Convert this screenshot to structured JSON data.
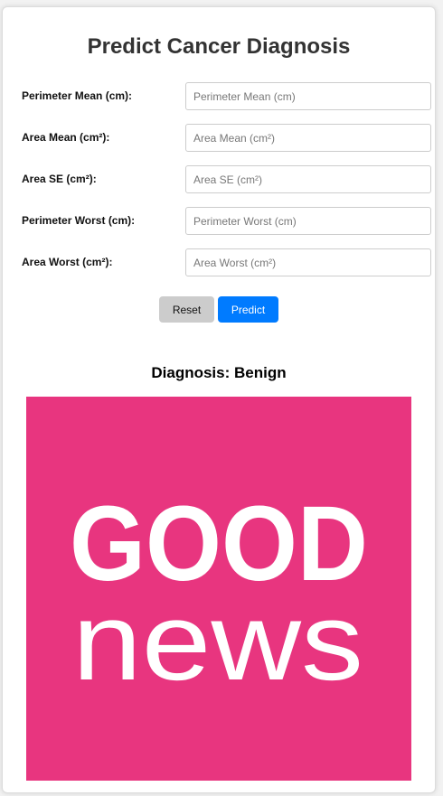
{
  "form": {
    "title": "Predict Cancer Diagnosis",
    "fields": [
      {
        "label": "Perimeter Mean (cm):",
        "placeholder": "Perimeter Mean (cm)",
        "value": ""
      },
      {
        "label": "Area Mean (cm²):",
        "placeholder": "Area Mean (cm²)",
        "value": ""
      },
      {
        "label": "Area SE (cm²):",
        "placeholder": "Area SE (cm²)",
        "value": ""
      },
      {
        "label": "Perimeter Worst (cm):",
        "placeholder": "Perimeter Worst (cm)",
        "value": ""
      },
      {
        "label": "Area Worst (cm²):",
        "placeholder": "Area Worst (cm²)",
        "value": ""
      }
    ],
    "buttons": {
      "reset_label": "Reset",
      "predict_label": "Predict"
    }
  },
  "result": {
    "diagnosis_text": "Diagnosis: Benign",
    "image": {
      "line1": "GOOD",
      "line2": "news",
      "background_color": "#e8357f",
      "text_color": "#ffffff"
    }
  },
  "colors": {
    "primary_button": "#007bff",
    "reset_button": "#cccccc"
  }
}
